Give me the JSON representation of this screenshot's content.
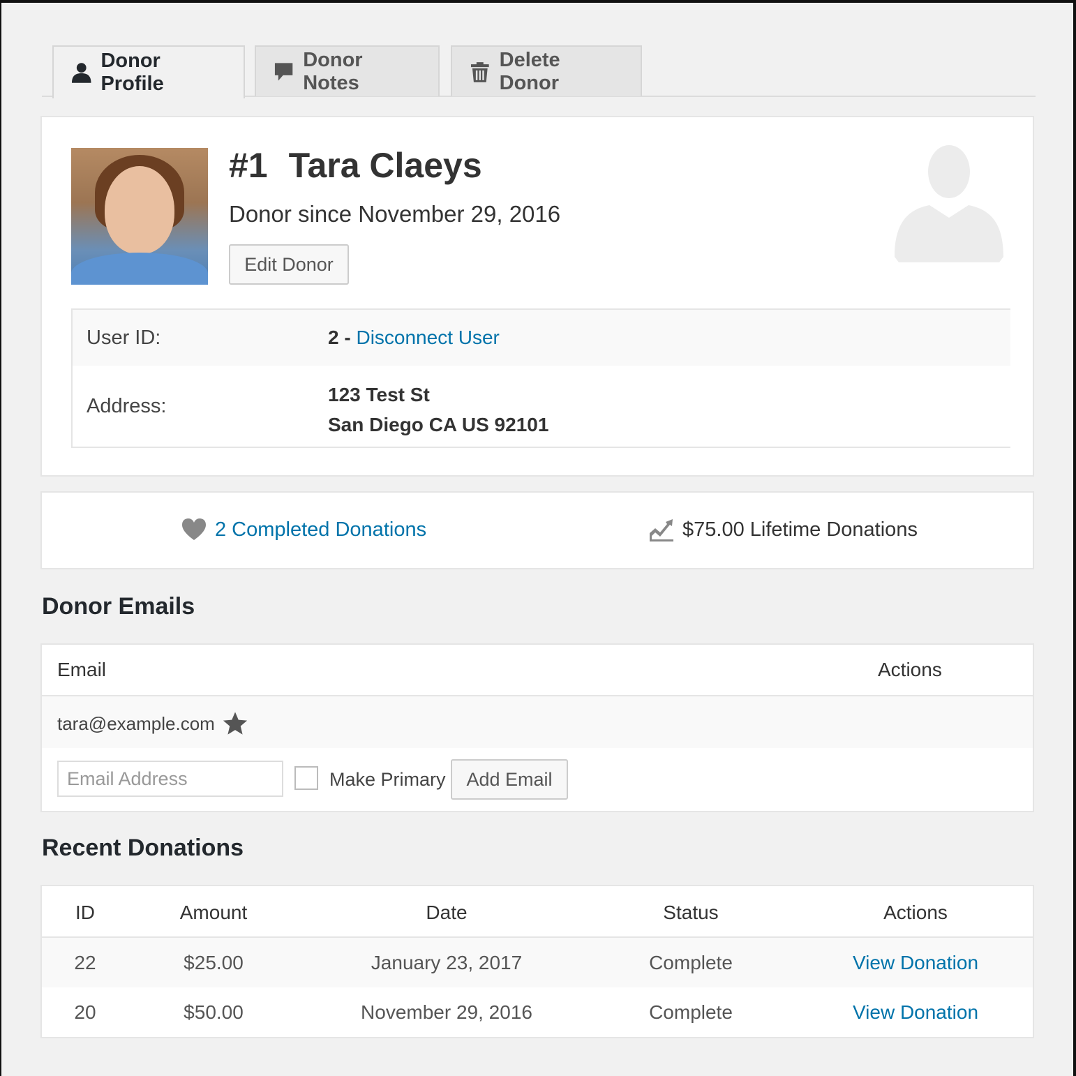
{
  "tabs": [
    {
      "label": "Donor Profile",
      "icon": "user-icon",
      "active": true
    },
    {
      "label": "Donor Notes",
      "icon": "comment-icon",
      "active": false
    },
    {
      "label": "Delete Donor",
      "icon": "trash-icon",
      "active": false
    }
  ],
  "profile": {
    "number": "#1",
    "name": "Tara Claeys",
    "since": "Donor since November 29, 2016",
    "edit_label": "Edit Donor",
    "user_id_label": "User ID:",
    "user_id_value": "2 -",
    "disconnect_label": "Disconnect User",
    "address_label": "Address:",
    "address_line1": "123 Test St",
    "address_line2": "San Diego CA US 92101"
  },
  "stats": {
    "completed": "2 Completed Donations",
    "lifetime": "$75.00 Lifetime Donations"
  },
  "emails": {
    "heading": "Donor Emails",
    "col_email": "Email",
    "col_actions": "Actions",
    "rows": [
      {
        "email": "tara@example.com",
        "primary": true
      }
    ],
    "input_placeholder": "Email Address",
    "make_primary_label": "Make Primary",
    "add_label": "Add Email"
  },
  "donations": {
    "heading": "Recent Donations",
    "columns": [
      "ID",
      "Amount",
      "Date",
      "Status",
      "Actions"
    ],
    "rows": [
      {
        "id": "22",
        "amount": "$25.00",
        "date": "January 23, 2017",
        "status": "Complete",
        "action": "View Donation"
      },
      {
        "id": "20",
        "amount": "$50.00",
        "date": "November 29, 2016",
        "status": "Complete",
        "action": "View Donation"
      }
    ]
  },
  "colors": {
    "link": "#0073aa",
    "background": "#f1f1f1"
  }
}
